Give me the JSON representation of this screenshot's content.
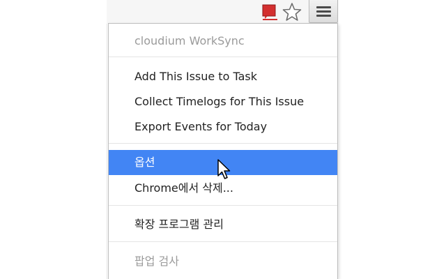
{
  "toolbar": {
    "extension_icon": "extension-red-flag-icon",
    "bookmark_icon": "star-icon",
    "menu_icon": "hamburger-menu-icon"
  },
  "menu": {
    "header": "cloudium WorkSync",
    "group1": [
      "Add This Issue to Task",
      "Collect Timelogs for This Issue",
      "Export Events for Today"
    ],
    "options_label": "옵션",
    "remove_label": "Chrome에서 삭제...",
    "manage_label": "확장 프로그램 관리",
    "inspect_label": "팝업 검사"
  },
  "colors": {
    "highlight": "#4285f4",
    "extension_icon": "#cc2a2a",
    "disabled_text": "#9a9a9a"
  }
}
